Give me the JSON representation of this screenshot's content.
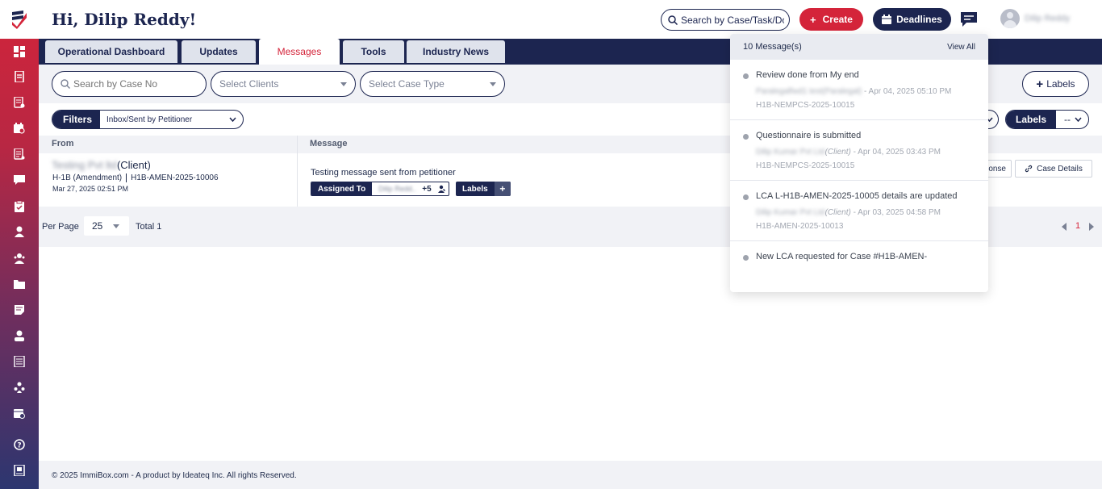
{
  "header": {
    "greeting": "Hi, Dilip Reddy!",
    "search_placeholder": "Search by Case/Task/Document",
    "create_label": "Create",
    "deadlines_label": "Deadlines",
    "user_name": "Dilip Reddy"
  },
  "tabs": [
    {
      "label": "Operational Dashboard"
    },
    {
      "label": "Updates"
    },
    {
      "label": "Messages"
    },
    {
      "label": "Tools"
    },
    {
      "label": "Industry News"
    }
  ],
  "filters": {
    "case_search_placeholder": "Search by Case No",
    "clients_placeholder": "Select Clients",
    "case_type_placeholder": "Select Case Type",
    "labels_button": "Labels",
    "filters_label": "Filters",
    "filter_value": "Inbox/Sent by Petitioner",
    "labels_label": "Labels",
    "labels_value": "--"
  },
  "table": {
    "col_from": "From",
    "col_message": "Message",
    "rows": [
      {
        "from_name_blurred": "Testing Pvt ltd",
        "from_role": "(Client)",
        "case_type": "H-1B (Amendment)",
        "case_no": "H1B-AMEN-2025-10006",
        "date": "Mar 27, 2025 02:51 PM",
        "message": "Testing message sent from petitioner",
        "assigned_label": "Assigned To",
        "assigned_names": "Dilip Redd..",
        "assigned_more": "+5",
        "labels_label": "Labels",
        "labels_add": "+",
        "response_label": "onse",
        "case_details_label": "Case Details"
      }
    ]
  },
  "pager": {
    "per_page_label": "Per Page",
    "per_page_value": "25",
    "total_label": "Total 1",
    "current_page": "1"
  },
  "footer": {
    "text": "© 2025 ImmiBox.com - A product by Ideateq Inc. All rights Reserved."
  },
  "messages_panel": {
    "count_label": "10 Message(s)",
    "view_all": "View All",
    "items": [
      {
        "title": "Review done from My end",
        "sender": "Paralegalfwd1 test(Paralegal)",
        "role": "",
        "time": " - Apr 04, 2025 05:10 PM",
        "case": "H1B-NEMPCS-2025-10015"
      },
      {
        "title": "Questionnaire is submitted",
        "sender": "Dilip Kumar Pvt Ltd",
        "role": "(Client)",
        "time": " - Apr 04, 2025 03:43 PM",
        "case": "H1B-NEMPCS-2025-10015"
      },
      {
        "title": "LCA L-H1B-AMEN-2025-10005 details are updated",
        "sender": "Dilip Kumar Pvt Ltd",
        "role": "(Client)",
        "time": " - Apr 03, 2025 04:58 PM",
        "case": "H1B-AMEN-2025-10013"
      },
      {
        "title": "New LCA requested for Case #H1B-AMEN-",
        "sender": "",
        "role": "",
        "time": "",
        "case": ""
      }
    ]
  },
  "colors": {
    "brand_navy": "#1c2550",
    "brand_red": "#d4243a",
    "background": "#f1f2f6"
  },
  "sidebar_icons": [
    "dashboard-icon",
    "document-icon",
    "form-icon",
    "calendar-case-icon",
    "report-icon",
    "chat-icon",
    "clipboard-check-icon",
    "user-icon",
    "users-icon",
    "folder-icon",
    "note-icon",
    "person-badge-icon",
    "ledger-icon",
    "team-icon",
    "schedule-icon",
    "help-icon",
    "book-icon"
  ]
}
